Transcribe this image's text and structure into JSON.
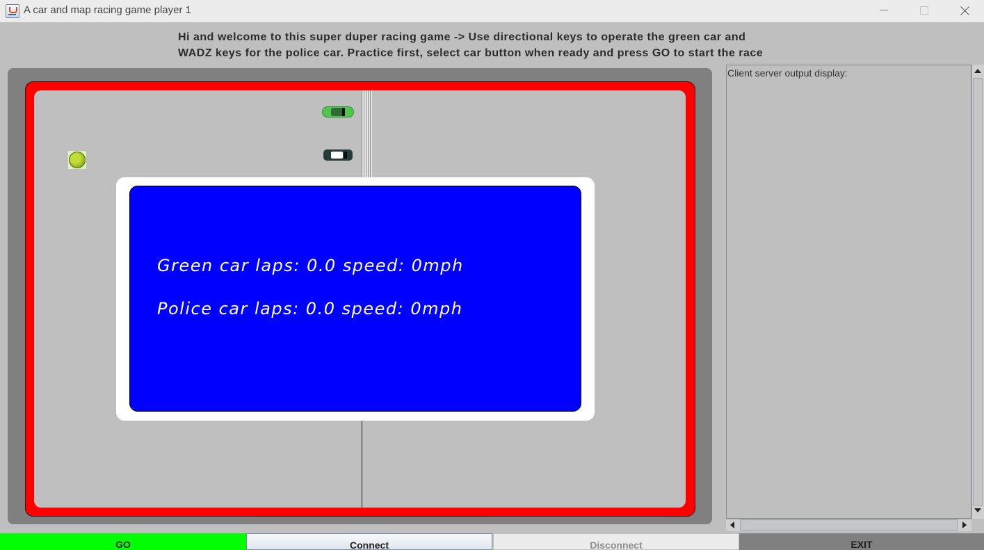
{
  "window": {
    "title": "A car and map racing game player 1"
  },
  "instructions": {
    "line1": "Hi and welcome to this super duper racing game -> Use directional keys to operate the green car and",
    "line2": "WADZ keys for the police car. Practice first, select car button when ready and press GO to start the race"
  },
  "scoreboard": {
    "green_line": "Green car laps: 0.0 speed: 0mph",
    "police_line": "Police car laps: 0.0 speed: 0mph",
    "background_color": "#0000ff"
  },
  "output": {
    "label": "Client server output display:"
  },
  "buttons": {
    "go": "GO",
    "connect": "Connect",
    "disconnect": "Disconnect",
    "exit": "EXIT"
  },
  "colors": {
    "track_border": "#ff0000",
    "go_button": "#00ff00",
    "exit_button": "#808080"
  },
  "icons": {
    "app": "java-coffee-icon",
    "tree": "tree-icon",
    "green_car": "green-car-sprite",
    "police_car": "police-car-sprite"
  }
}
